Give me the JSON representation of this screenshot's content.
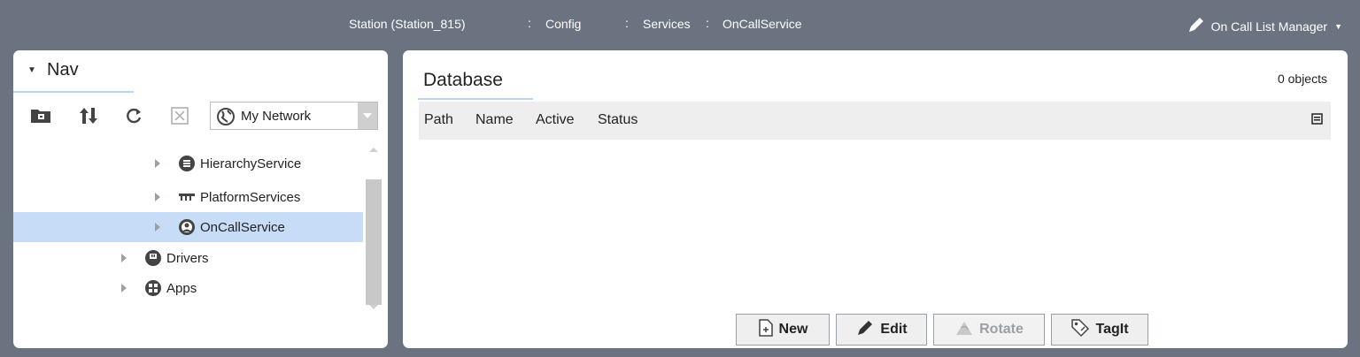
{
  "breadcrumb": {
    "station": "Station (Station_815)",
    "sep": ":",
    "config": "Config",
    "services": "Services",
    "oncall": "OnCallService"
  },
  "profile": {
    "label": "On Call List Manager"
  },
  "nav": {
    "title": "Nav",
    "network_select": "My Network",
    "tree": [
      {
        "label": "HierarchyService",
        "icon": "hierarchy-icon",
        "selected": false
      },
      {
        "label": "PlatformServices",
        "icon": "platform-icon",
        "selected": false
      },
      {
        "label": "OnCallService",
        "icon": "oncall-icon",
        "selected": true
      },
      {
        "label": "Drivers",
        "icon": "drivers-icon",
        "selected": false
      },
      {
        "label": "Apps",
        "icon": "apps-icon",
        "selected": false
      }
    ]
  },
  "main": {
    "tab": "Database",
    "object_count": "0 objects",
    "columns": [
      "Path",
      "Name",
      "Active",
      "Status"
    ],
    "buttons": {
      "new": "New",
      "edit": "Edit",
      "rotate": "Rotate",
      "tagit": "TagIt"
    }
  },
  "colors": {
    "chrome": "#6b7280",
    "selection": "#c7dcf6",
    "tab_underline": "#b7d5f7"
  }
}
